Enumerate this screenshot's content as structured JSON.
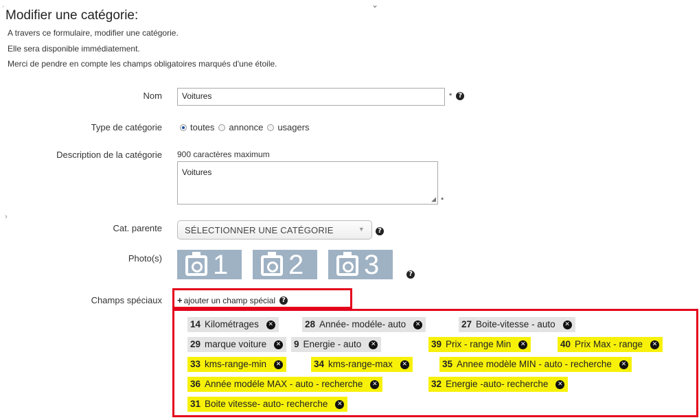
{
  "page": {
    "title": "Modifier une catégorie:",
    "intro": [
      "A travers ce formulaire, modifier une catégorie.",
      "Elle sera disponible immédiatement.",
      "Merci de pendre en compte les champs obligatoires marqués d'une étoile."
    ]
  },
  "form": {
    "nom": {
      "label": "Nom",
      "value": "Voitures",
      "required": "*"
    },
    "type": {
      "label": "Type de catégorie",
      "options": [
        "toutes",
        "annonce",
        "usagers"
      ],
      "selected": "toutes"
    },
    "description": {
      "label": "Description de la catégorie",
      "hint": "900 caractères maximum",
      "value": "Voitures",
      "required": "*"
    },
    "parent": {
      "label": "Cat. parente",
      "value": "SÉLECTIONNER UNE CATÉGORIE"
    },
    "photos": {
      "label": "Photo(s)",
      "slots": [
        "1",
        "2",
        "3"
      ]
    },
    "special": {
      "label": "Champs spéciaux",
      "add_link": "ajouter un champ spécial",
      "tags": [
        {
          "id": "14",
          "name": "Kilométrages",
          "color": "gray"
        },
        {
          "id": "28",
          "name": "Année- modéle- auto",
          "color": "gray"
        },
        {
          "id": "27",
          "name": "Boite-vitesse - auto",
          "color": "gray"
        },
        {
          "id": "29",
          "name": "marque voiture",
          "color": "gray"
        },
        {
          "id": "9",
          "name": "Energie - auto",
          "color": "gray"
        },
        {
          "id": "39",
          "name": "Prix - range Min",
          "color": "yellow"
        },
        {
          "id": "40",
          "name": "Prix Max - range",
          "color": "yellow"
        },
        {
          "id": "33",
          "name": "kms-range-min",
          "color": "yellow"
        },
        {
          "id": "34",
          "name": "kms-range-max",
          "color": "yellow"
        },
        {
          "id": "35",
          "name": "Annee modèle MIN - auto - recherche",
          "color": "yellow"
        },
        {
          "id": "36",
          "name": "Année modéle MAX - auto - recherche",
          "color": "yellow"
        },
        {
          "id": "32",
          "name": "Energie -auto- recherche",
          "color": "yellow"
        },
        {
          "id": "31",
          "name": "Boite vitesse- auto- recherche",
          "color": "yellow"
        }
      ]
    }
  },
  "colors": {
    "gray_tag": "#e3e3e3",
    "yellow_tag": "#f7f10a",
    "highlight_box": "#e3001b",
    "photo_bg": "#9fb2c4"
  }
}
